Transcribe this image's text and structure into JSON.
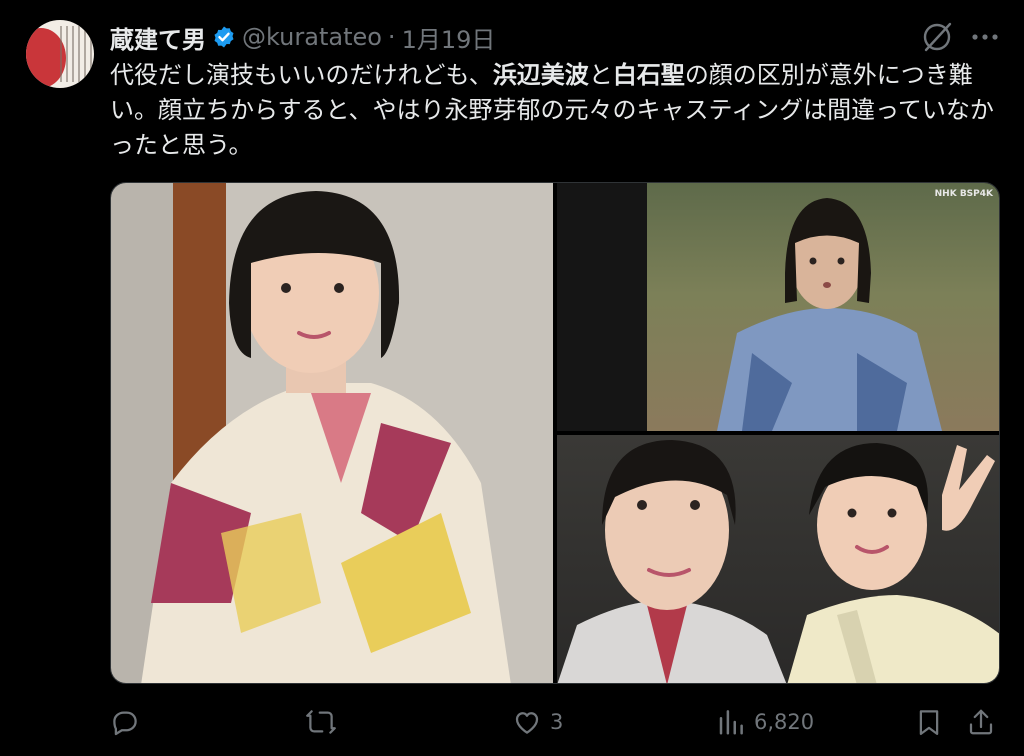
{
  "author": {
    "name": "蔵建て男",
    "handle": "@kuratateo",
    "separator": "·",
    "date": "1月19日",
    "verified_color": "#1d9bf0"
  },
  "tweet": {
    "text_1": "代役だし演技もいいのだけれども、",
    "bold_1": "浜辺美波",
    "text_2": "と",
    "bold_2": "白石聖",
    "text_3": "の顔の区別が意外につき難い。顔立ちからすると、やはり永野芽郁の元々のキャスティングは間違っていなかったと思う。"
  },
  "media": {
    "watermark": "NHK BSP4K",
    "photos": [
      "photo-1",
      "photo-2",
      "photo-3"
    ]
  },
  "actions": {
    "reply_icon": "reply-icon",
    "retweet_icon": "retweet-icon",
    "like_count": "3",
    "views_count": "6,820"
  }
}
